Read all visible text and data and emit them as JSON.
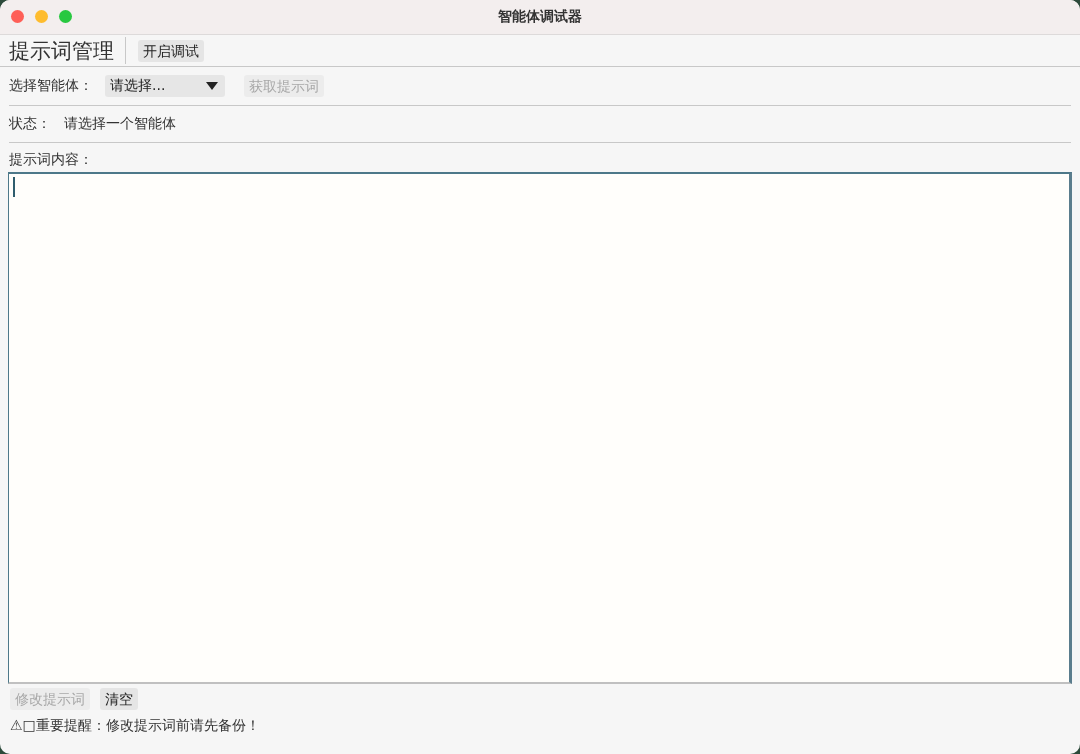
{
  "window": {
    "title": "智能体调试器"
  },
  "toolbar": {
    "heading": "提示词管理",
    "buttons": [
      {
        "label": "开启调试",
        "disabled": false
      }
    ]
  },
  "agent_row": {
    "label": "选择智能体：",
    "select": {
      "value": "请选择..."
    },
    "buttons": [
      {
        "label": "获取提示词",
        "disabled": true
      }
    ]
  },
  "status": {
    "label": "状态：",
    "value": "请选择一个智能体"
  },
  "editor": {
    "label": "提示词内容：",
    "focused": true
  },
  "actions": [
    {
      "label": "修改提示词",
      "disabled": true
    },
    {
      "label": "清空",
      "disabled": false
    }
  ],
  "notice": "⚠□重要提醒：修改提示词前请先备份！"
}
